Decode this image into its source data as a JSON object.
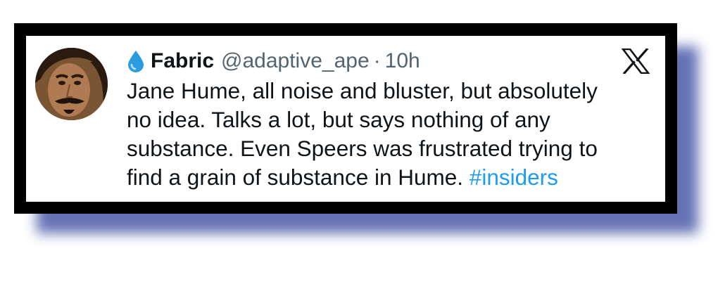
{
  "tweet": {
    "display_name": "Fabric",
    "handle": "@adaptive_ape",
    "separator": "·",
    "time": "10h",
    "lines": [
      "Jane Hume, all noise and bluster, but absolutely",
      "no idea. Talks a lot, but says nothing of any",
      "substance. Even Speers was frustrated trying to",
      "find a grain of substance in Hume."
    ],
    "hashtag": "#insiders"
  },
  "icons": {
    "name_emoji": "droplet-icon",
    "platform": "x-logo-icon"
  },
  "colors": {
    "hashtag": "#1d9bf0",
    "droplet": "#2b9be0",
    "shadow": "#4a5aa8",
    "frame": "#000000"
  }
}
